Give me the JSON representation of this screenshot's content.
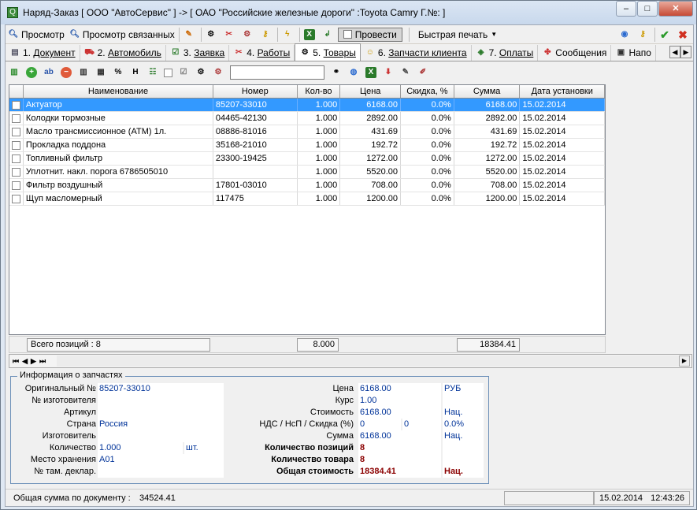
{
  "window": {
    "title": "Наряд-Заказ [ ООО \"АвтоСервис\" ] -> [ ОАО \"Российские железные дороги\" :Toyota Camry Г.№: ]"
  },
  "toolbar": {
    "view": "Просмотр",
    "view_related": "Просмотр связанных",
    "post": "Провести",
    "quick_print": "Быстрая печать"
  },
  "tabs": [
    {
      "num": "1.",
      "label": "Документ"
    },
    {
      "num": "2.",
      "label": "Автомобиль"
    },
    {
      "num": "3.",
      "label": "Заявка"
    },
    {
      "num": "4.",
      "label": "Работы"
    },
    {
      "num": "5.",
      "label": "Товары"
    },
    {
      "num": "6.",
      "label": "Запчасти клиента"
    },
    {
      "num": "7.",
      "label": "Оплаты"
    },
    {
      "num": "",
      "label": "Сообщения"
    },
    {
      "num": "",
      "label": "Напо"
    }
  ],
  "grid": {
    "headers": [
      "Наименование",
      "Номер",
      "Кол-во",
      "Цена",
      "Скидка, %",
      "Сумма",
      "Дата установки"
    ],
    "rows": [
      [
        "Актуатор",
        "85207-33010",
        "1.000",
        "6168.00",
        "0.0%",
        "6168.00",
        "15.02.2014"
      ],
      [
        "Колодки тормозные",
        "04465-42130",
        "1.000",
        "2892.00",
        "0.0%",
        "2892.00",
        "15.02.2014"
      ],
      [
        "Масло трансмиссионное (ATM) 1л.",
        "08886-81016",
        "1.000",
        "431.69",
        "0.0%",
        "431.69",
        "15.02.2014"
      ],
      [
        "Прокладка поддона",
        "35168-21010",
        "1.000",
        "192.72",
        "0.0%",
        "192.72",
        "15.02.2014"
      ],
      [
        "Топливный фильтр",
        "23300-19425",
        "1.000",
        "1272.00",
        "0.0%",
        "1272.00",
        "15.02.2014"
      ],
      [
        "Уплотнит. накл. порога 6786505010",
        "",
        "1.000",
        "5520.00",
        "0.0%",
        "5520.00",
        "15.02.2014"
      ],
      [
        "Фильтр воздушный",
        "17801-03010",
        "1.000",
        "708.00",
        "0.0%",
        "708.00",
        "15.02.2014"
      ],
      [
        "Щуп масломерный",
        "117475",
        "1.000",
        "1200.00",
        "0.0%",
        "1200.00",
        "15.02.2014"
      ]
    ],
    "footer": {
      "total_positions": "Всего позиций : 8",
      "qty_total": "8.000",
      "sum_total": "18384.41"
    }
  },
  "info": {
    "legend": "Информация о запчастях",
    "left": [
      {
        "label": "Оригинальный №",
        "value": "85207-33010"
      },
      {
        "label": "№ изготовителя",
        "value": ""
      },
      {
        "label": "Артикул",
        "value": ""
      },
      {
        "label": "Страна",
        "value": "Россия"
      },
      {
        "label": "Изготовитель",
        "value": ""
      },
      {
        "label": "Количество",
        "value": "1.000",
        "unit": "шт."
      },
      {
        "label": "Место хранения",
        "value": "A01"
      },
      {
        "label": "№ там. деклар.",
        "value": ""
      }
    ],
    "right": [
      {
        "label": "Цена",
        "value": "6168.00",
        "extra": "РУБ"
      },
      {
        "label": "Курс",
        "value": "1.00",
        "extra": ""
      },
      {
        "label": "Стоимость",
        "value": "6168.00",
        "extra": "Нац."
      },
      {
        "label": "НДС / НсП / Скидка (%)",
        "value": "0",
        "value2": "0",
        "extra": "0.0%"
      },
      {
        "label": "Сумма",
        "value": "6168.00",
        "extra": "Нац."
      },
      {
        "label": "Количество позиций",
        "value": "8",
        "extra": ""
      },
      {
        "label": "Количество товара",
        "value": "8",
        "extra": ""
      },
      {
        "label": "Общая стоимость",
        "value": "18384.41",
        "extra": "Нац."
      }
    ]
  },
  "status": {
    "doc_sum_label": "Общая сумма по документу :",
    "doc_sum": "34524.41",
    "date": "15.02.2014",
    "time": "12:43:26"
  }
}
